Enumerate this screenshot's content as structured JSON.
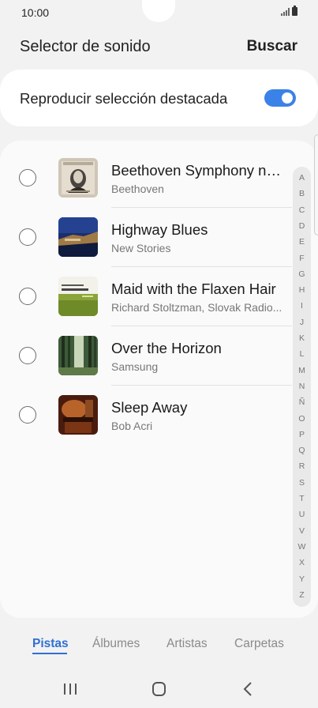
{
  "status_bar": {
    "time": "10:00"
  },
  "header": {
    "title": "Selector de sonido",
    "search_label": "Buscar"
  },
  "highlight": {
    "label": "Reproducir selección destacada",
    "enabled": true
  },
  "tracks": [
    {
      "title": "Beethoven Symphony no....",
      "artist": "Beethoven"
    },
    {
      "title": "Highway Blues",
      "artist": "New Stories"
    },
    {
      "title": "Maid with the Flaxen Hair",
      "artist": "Richard Stoltzman, Slovak Radio..."
    },
    {
      "title": "Over the Horizon",
      "artist": "Samsung"
    },
    {
      "title": "Sleep Away",
      "artist": "Bob Acri"
    }
  ],
  "index_letters": [
    "A",
    "B",
    "C",
    "D",
    "E",
    "F",
    "G",
    "H",
    "I",
    "J",
    "K",
    "L",
    "M",
    "N",
    "Ñ",
    "O",
    "P",
    "Q",
    "R",
    "S",
    "T",
    "U",
    "V",
    "W",
    "X",
    "Y",
    "Z"
  ],
  "tabs": [
    {
      "label": "Pistas",
      "active": true
    },
    {
      "label": "Álbumes",
      "active": false
    },
    {
      "label": "Artistas",
      "active": false
    },
    {
      "label": "Carpetas",
      "active": false
    }
  ],
  "colors": {
    "accent": "#2f6fd3",
    "toggle": "#3b82e8"
  }
}
